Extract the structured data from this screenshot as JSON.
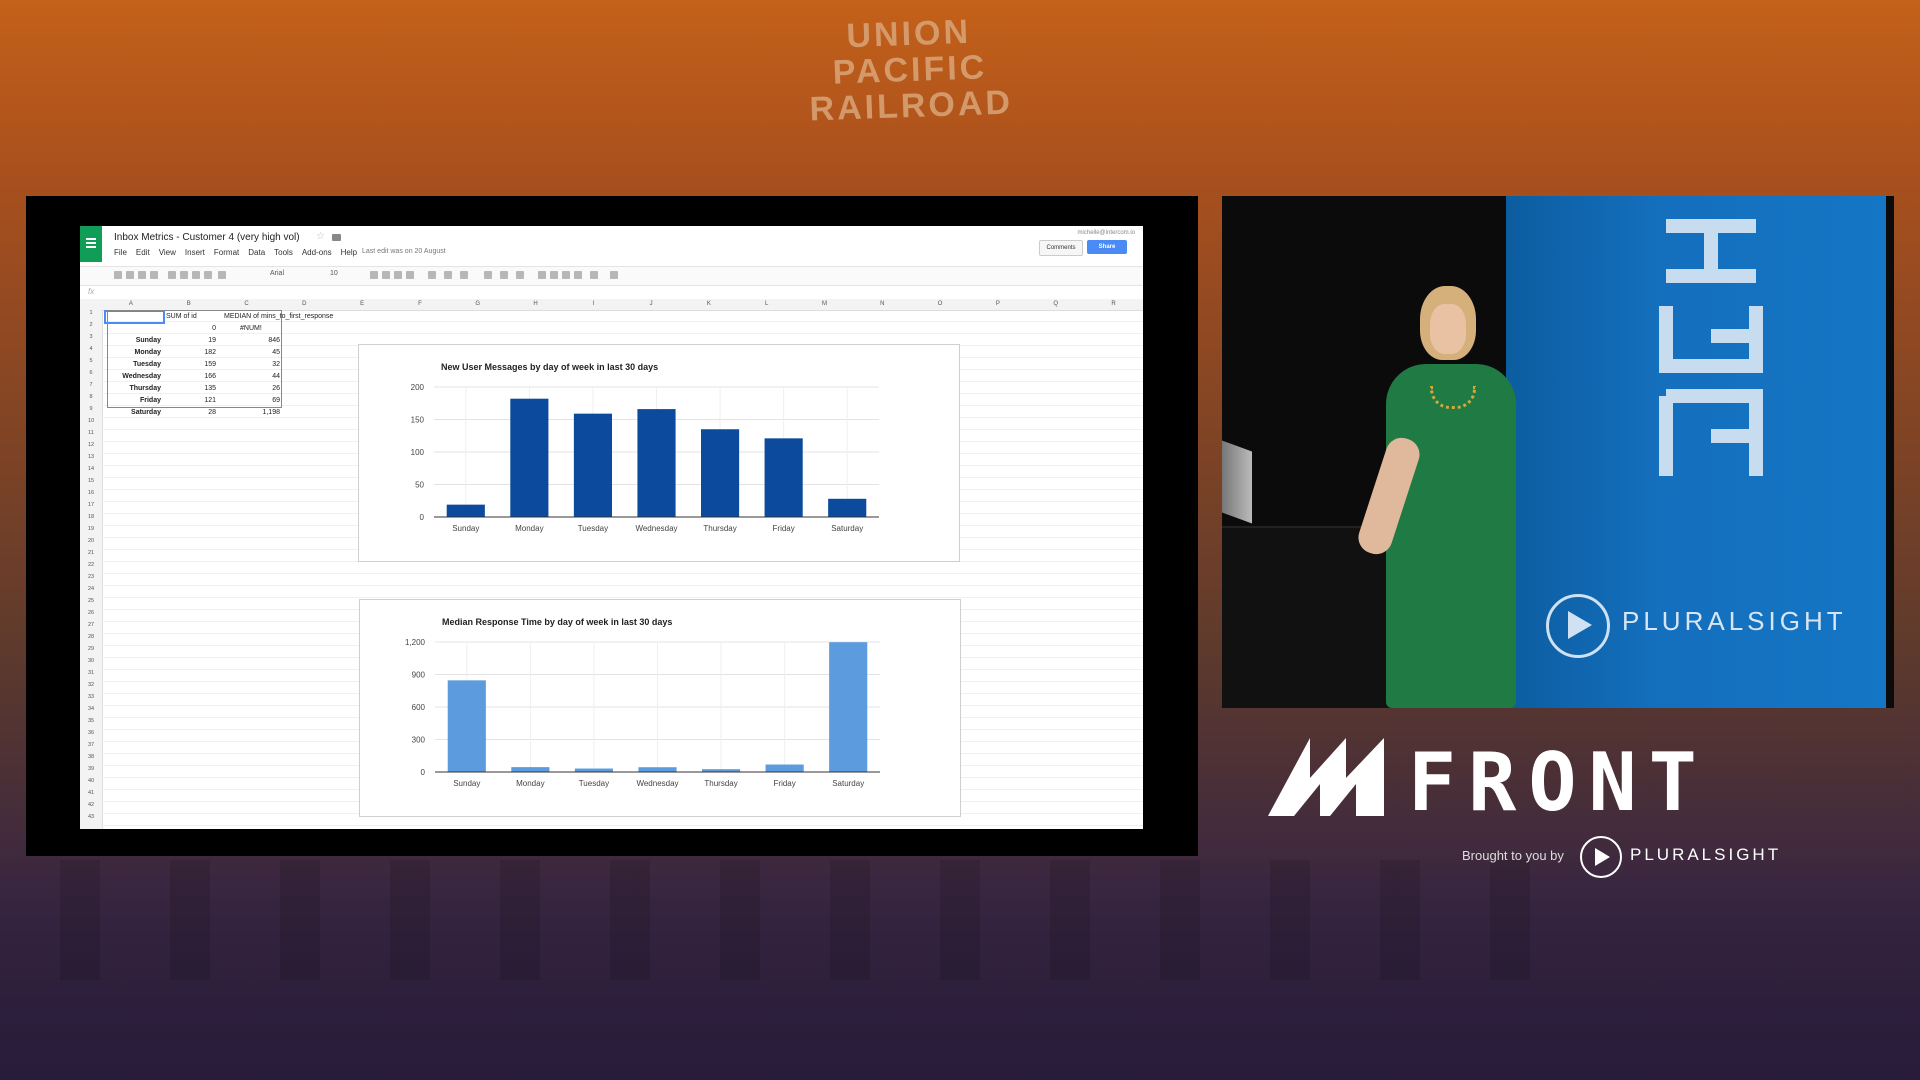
{
  "background": {
    "sign_text": [
      "UNION",
      "PACIFIC",
      "RAILROAD"
    ]
  },
  "spreadsheet": {
    "title": "Inbox Metrics - Customer 4 (very high vol)",
    "menu": [
      "File",
      "Edit",
      "View",
      "Insert",
      "Format",
      "Data",
      "Tools",
      "Add-ons",
      "Help"
    ],
    "last_edit": "Last edit was on 20 August",
    "account": "michelle@intercom.io",
    "comments_label": "Comments",
    "share_label": "Share",
    "toolbar": {
      "font": "Arial",
      "size": "10"
    },
    "fx": "fx",
    "columns": [
      "A",
      "B",
      "C",
      "D",
      "E",
      "F",
      "G",
      "H",
      "I",
      "J",
      "K",
      "L",
      "M",
      "N",
      "O",
      "P",
      "Q",
      "R"
    ],
    "row_count": 43,
    "pivot": {
      "header_b": "SUM of id",
      "header_c": "MEDIAN of mins_to_first_response",
      "row2_b": "0",
      "row2_c": "#NUM!",
      "rows": [
        {
          "day": "Sunday",
          "sum": "19",
          "median": "846"
        },
        {
          "day": "Monday",
          "sum": "182",
          "median": "45"
        },
        {
          "day": "Tuesday",
          "sum": "159",
          "median": "32"
        },
        {
          "day": "Wednesday",
          "sum": "166",
          "median": "44"
        },
        {
          "day": "Thursday",
          "sum": "135",
          "median": "26"
        },
        {
          "day": "Friday",
          "sum": "121",
          "median": "69"
        },
        {
          "day": "Saturday",
          "sum": "28",
          "median": "1,198"
        }
      ]
    }
  },
  "chart_data": [
    {
      "type": "bar",
      "title": "New User Messages by day of week in last 30 days",
      "categories": [
        "Sunday",
        "Monday",
        "Tuesday",
        "Wednesday",
        "Thursday",
        "Friday",
        "Saturday"
      ],
      "values": [
        19,
        182,
        159,
        166,
        135,
        121,
        28
      ],
      "yticks": [
        "0",
        "50",
        "100",
        "150",
        "200"
      ],
      "ylim": [
        0,
        200
      ],
      "color": "#0b4a9c",
      "grid": true
    },
    {
      "type": "bar",
      "title": "Median Response Time by day of week in last 30 days",
      "categories": [
        "Sunday",
        "Monday",
        "Tuesday",
        "Wednesday",
        "Thursday",
        "Friday",
        "Saturday"
      ],
      "values": [
        846,
        45,
        32,
        44,
        26,
        69,
        1198
      ],
      "yticks": [
        "0",
        "300",
        "600",
        "900",
        "1,200"
      ],
      "ylim": [
        0,
        1200
      ],
      "color": "#5b9bde",
      "grid": true
    }
  ],
  "branding": {
    "pluralsight_banner": "PLURALSIGHT",
    "front_word": "FRONT",
    "brought_by": "Brought to you by",
    "pluralsight_footer": "PLURALSIGHT"
  }
}
